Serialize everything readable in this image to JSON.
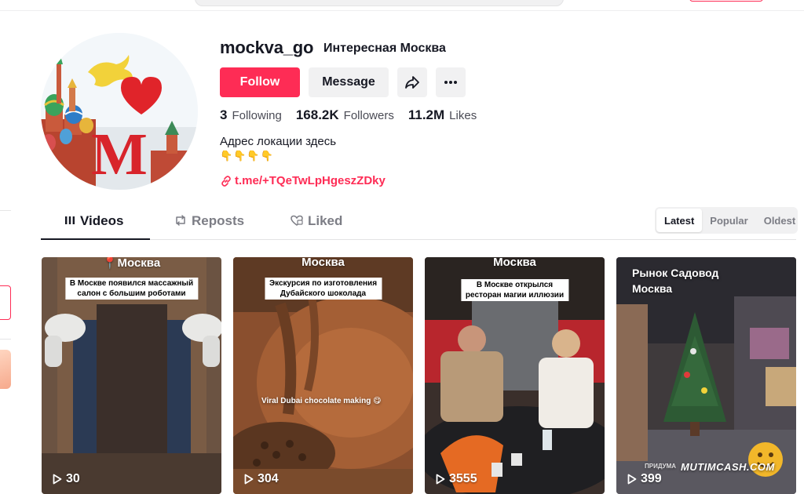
{
  "profile": {
    "username": "mockva_go",
    "nickname": "Интересная Москва",
    "follow_label": "Follow",
    "message_label": "Message",
    "avatar_letter": "M",
    "stats": [
      {
        "number": "3",
        "label": "Following"
      },
      {
        "number": "168.2K",
        "label": "Followers"
      },
      {
        "number": "11.2M",
        "label": "Likes"
      }
    ],
    "bio": "Адрес локации здесь",
    "bio_emojis": "👇👇👇👇",
    "link": "t.me/+TQeTwLpHgeszZDky"
  },
  "tabs": [
    {
      "label": "Videos",
      "active": true
    },
    {
      "label": "Reposts",
      "active": false
    },
    {
      "label": "Liked",
      "active": false
    }
  ],
  "sort": {
    "options": [
      "Latest",
      "Popular",
      "Oldest"
    ],
    "selected": "Latest"
  },
  "colors": {
    "accent": "#fe2c55",
    "text": "#161823",
    "muted": "#7c7d85",
    "button_bg": "#f1f1f2"
  },
  "videos": [
    {
      "location": "📍Москва",
      "caption": [
        "В Москве появился массажный",
        "салон с большим роботами"
      ],
      "views": "30"
    },
    {
      "location": "Москва",
      "caption": [
        "Экскурсия по изготовления",
        "Дубайского шоколада"
      ],
      "overlay": "Viral Dubai chocolate making 😋",
      "views": "304"
    },
    {
      "location": "Москва",
      "caption": [
        "В Москве открылся",
        "ресторан магии иллюзии"
      ],
      "views": "3555"
    },
    {
      "location": "Рынок Садовод\nМосква",
      "caption": [],
      "watermark": "MUTIMCASH.COM",
      "small_text": "ПРИДУМА",
      "views": "399"
    }
  ],
  "icons": [
    "videos-grid-icon",
    "repost-icon",
    "liked-heart-icon",
    "share-icon",
    "more-icon",
    "link-icon",
    "play-icon"
  ]
}
